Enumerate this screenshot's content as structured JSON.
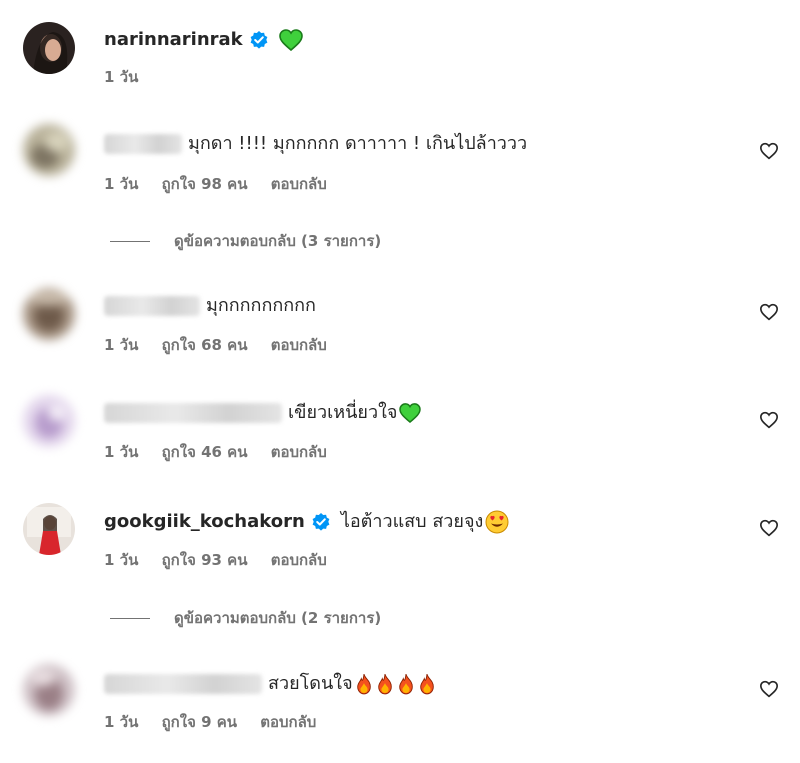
{
  "caption": {
    "username": "narinnarinrak",
    "verified": true,
    "text_emoji": "green-heart",
    "time": "1 วัน"
  },
  "comments": [
    {
      "username_hidden": true,
      "text": "มุกดา !!!! มุกกกกก ดาาาาา ! เกินไปล้าววว",
      "time": "1 วัน",
      "likes": "ถูกใจ 98 คน",
      "reply": "ตอบกลับ",
      "view_replies": "ดูข้อความตอบกลับ (3 รายการ)"
    },
    {
      "username_hidden": true,
      "text": "มุกกกกกกกกก",
      "time": "1 วัน",
      "likes": "ถูกใจ 68 คน",
      "reply": "ตอบกลับ"
    },
    {
      "username_hidden": true,
      "text": "เขียวเหนี่ยวใจ",
      "emoji": "green-heart",
      "time": "1 วัน",
      "likes": "ถูกใจ 46 คน",
      "reply": "ตอบกลับ"
    },
    {
      "username": "gookgiik_kochakorn",
      "verified": true,
      "text": "ไอต้าวแสบ สวยจุง",
      "emoji": "heart-eyes",
      "time": "1 วัน",
      "likes": "ถูกใจ 93 คน",
      "reply": "ตอบกลับ",
      "view_replies": "ดูข้อความตอบกลับ (2 รายการ)"
    },
    {
      "username_hidden": true,
      "text": "สวยโดนใจ",
      "emoji": "fire x4",
      "time": "1 วัน",
      "likes": "ถูกใจ 9 คน",
      "reply": "ตอบกลับ"
    }
  ],
  "colors": {
    "verified_blue": "#0095f6",
    "green_heart": "#2ecc40",
    "meta_gray": "#737373",
    "text": "#262626"
  }
}
